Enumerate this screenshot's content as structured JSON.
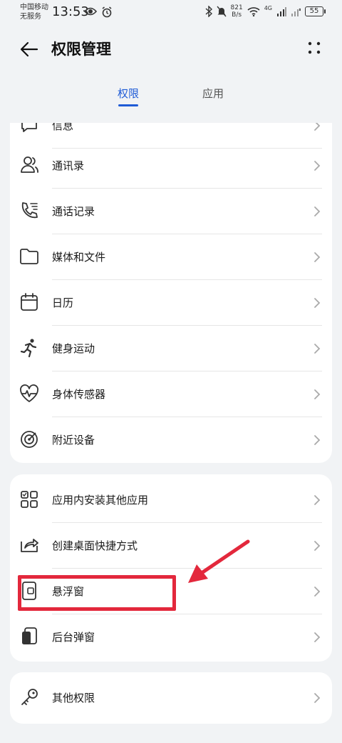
{
  "status_bar": {
    "carrier_line1": "中国移动",
    "carrier_line2": "无服务",
    "time": "13:53",
    "network_speed_value": "821",
    "network_speed_unit": "B/s",
    "network_type": "4G",
    "battery_level": "55"
  },
  "header": {
    "title": "权限管理"
  },
  "tabs": [
    {
      "label": "权限",
      "selected": true
    },
    {
      "label": "应用",
      "selected": false
    }
  ],
  "card1": {
    "partial_item_label": "信息",
    "items": [
      {
        "label": "通讯录",
        "icon": "contacts-icon"
      },
      {
        "label": "通话记录",
        "icon": "call-log-icon"
      },
      {
        "label": "媒体和文件",
        "icon": "folder-icon"
      },
      {
        "label": "日历",
        "icon": "calendar-icon"
      },
      {
        "label": "健身运动",
        "icon": "running-icon"
      },
      {
        "label": "身体传感器",
        "icon": "heart-rate-icon"
      },
      {
        "label": "附近设备",
        "icon": "nearby-devices-icon"
      }
    ]
  },
  "card2": {
    "items": [
      {
        "label": "应用内安装其他应用",
        "icon": "install-apps-icon"
      },
      {
        "label": "创建桌面快捷方式",
        "icon": "shortcut-icon"
      },
      {
        "label": "悬浮窗",
        "icon": "floating-window-icon"
      },
      {
        "label": "后台弹窗",
        "icon": "background-popup-icon"
      }
    ]
  },
  "card3": {
    "items": [
      {
        "label": "其他权限",
        "icon": "key-icon"
      }
    ]
  },
  "colors": {
    "accent": "#1f5bd6",
    "annotation": "#e3283c",
    "background": "#f1f3f5",
    "card": "#ffffff"
  }
}
